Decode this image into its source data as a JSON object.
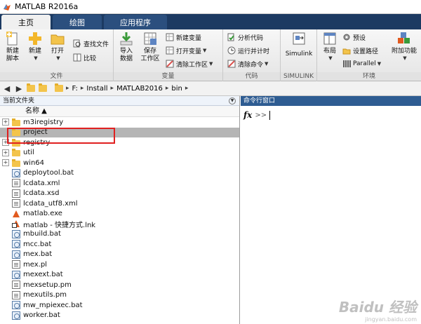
{
  "window": {
    "title": "MATLAB R2016a"
  },
  "tabs": [
    {
      "label": "主页",
      "active": true
    },
    {
      "label": "绘图",
      "active": false
    },
    {
      "label": "应用程序",
      "active": false
    }
  ],
  "ribbon": {
    "file_group": {
      "label": "文件",
      "new_script": "新建\n脚本",
      "new": "新建",
      "open": "打开",
      "find_files": "查找文件",
      "compare": "比较"
    },
    "variable_group": {
      "label": "变量",
      "import_data": "导入\n数据",
      "save_workspace": "保存\n工作区",
      "new_variable": "新建变量",
      "open_variable": "打开变量",
      "clear_workspace": "清除工作区"
    },
    "code_group": {
      "label": "代码",
      "analyze_code": "分析代码",
      "run_and_time": "运行并计时",
      "clear_commands": "清除命令"
    },
    "simulink_group": {
      "label": "SIMULINK",
      "simulink": "Simulink"
    },
    "environment_group": {
      "label": "环境",
      "layout": "布局",
      "preferences": "预设",
      "set_path": "设置路径",
      "parallel": "Parallel",
      "addons": "附加功能"
    }
  },
  "address": {
    "path": [
      "F:",
      "Install",
      "MATLAB2016",
      "bin"
    ]
  },
  "current_folder": {
    "header": "当前文件夹",
    "column_name": "名称 ▲",
    "items": [
      {
        "name": "m3iregistry",
        "type": "folder",
        "expandable": true,
        "selected": false
      },
      {
        "name": "project",
        "type": "folder",
        "expandable": false,
        "selected": true
      },
      {
        "name": "registry",
        "type": "folder",
        "expandable": true,
        "selected": false
      },
      {
        "name": "util",
        "type": "folder",
        "expandable": true,
        "selected": false
      },
      {
        "name": "win64",
        "type": "folder",
        "expandable": true,
        "selected": false
      },
      {
        "name": "deploytool.bat",
        "type": "bat",
        "expandable": false,
        "selected": false
      },
      {
        "name": "lcdata.xml",
        "type": "doc",
        "expandable": false,
        "selected": false
      },
      {
        "name": "lcdata.xsd",
        "type": "doc",
        "expandable": false,
        "selected": false
      },
      {
        "name": "lcdata_utf8.xml",
        "type": "doc",
        "expandable": false,
        "selected": false
      },
      {
        "name": "matlab.exe",
        "type": "exe",
        "expandable": false,
        "selected": false
      },
      {
        "name": "matlab - 快捷方式.lnk",
        "type": "link",
        "expandable": false,
        "selected": false
      },
      {
        "name": "mbuild.bat",
        "type": "bat",
        "expandable": false,
        "selected": false
      },
      {
        "name": "mcc.bat",
        "type": "bat",
        "expandable": false,
        "selected": false
      },
      {
        "name": "mex.bat",
        "type": "bat",
        "expandable": false,
        "selected": false
      },
      {
        "name": "mex.pl",
        "type": "doc",
        "expandable": false,
        "selected": false
      },
      {
        "name": "mexext.bat",
        "type": "bat",
        "expandable": false,
        "selected": false
      },
      {
        "name": "mexsetup.pm",
        "type": "doc",
        "expandable": false,
        "selected": false
      },
      {
        "name": "mexutils.pm",
        "type": "doc",
        "expandable": false,
        "selected": false
      },
      {
        "name": "mw_mpiexec.bat",
        "type": "bat",
        "expandable": false,
        "selected": false
      },
      {
        "name": "worker.bat",
        "type": "bat",
        "expandable": false,
        "selected": false
      }
    ]
  },
  "command_window": {
    "header": "命令行窗口",
    "fx": "fx",
    "prompt": ">>"
  },
  "watermark": {
    "main": "Baidu 经验",
    "sub": "jingyan.baidu.com"
  },
  "colors": {
    "tabbar": "#1c3a62",
    "cmd_header": "#2e5c92",
    "highlight_box": "#e02020",
    "selected_row": "#b5b5b5"
  }
}
